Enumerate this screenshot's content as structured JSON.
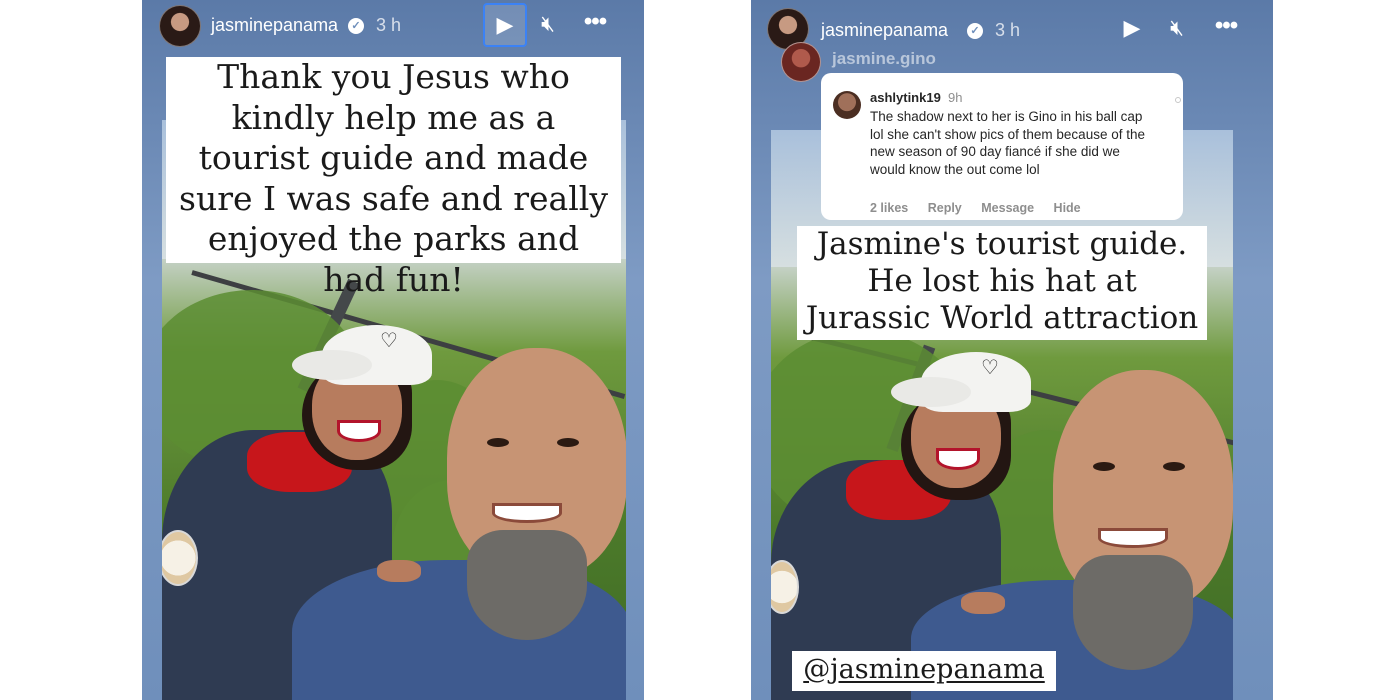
{
  "left_story": {
    "username": "jasminepanama",
    "time": "3 h",
    "icons": {
      "verified": "verified-badge-icon",
      "play": "play-icon",
      "mute": "mute-icon",
      "more": "more-icon"
    },
    "caption": "Thank you Jesus who kindly help me as a tourist guide and made sure I was safe and really enjoyed the parks and had fun!"
  },
  "right_story": {
    "username": "jasminepanama",
    "time": "3 h",
    "icons": {
      "verified": "verified-badge-icon",
      "play": "play-icon",
      "mute": "mute-icon",
      "more": "more-icon"
    },
    "shared_from": "jasmine.gino",
    "comment": {
      "user": "ashlytink19",
      "time": "9h",
      "text": "The shadow next to her is Gino in his ball cap lol she can't show pics of them because of the new season of 90 day fiancé if she did we would know the out come lol",
      "likes": "2 likes",
      "reply": "Reply",
      "message": "Message",
      "hide": "Hide"
    },
    "caption": "Jasmine's tourist guide. He lost his hat at Jurassic World attraction",
    "mention": "@jasminepanama"
  },
  "colors": {
    "focus_ring": "#3b82f6",
    "story_bg": "#6f8fbb",
    "sweater_red": "#c7161b"
  }
}
